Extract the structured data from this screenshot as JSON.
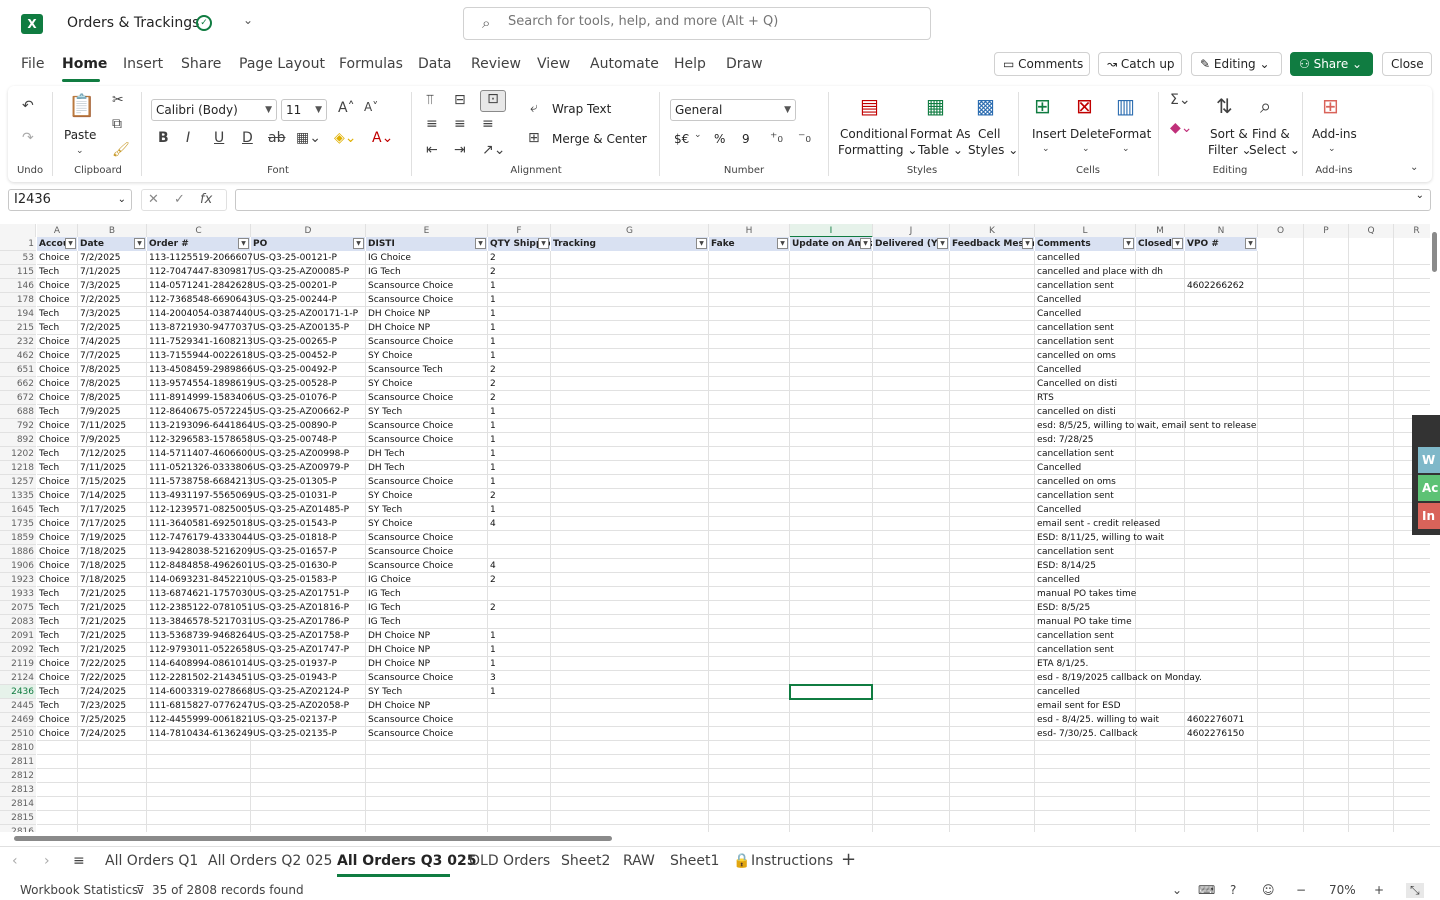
{
  "app": {
    "title": "Orders & Trackings",
    "logo_letter": "X",
    "search_placeholder": "Search for tools, help, and more (Alt + Q)"
  },
  "menu": [
    "File",
    "Home",
    "Insert",
    "Share",
    "Page Layout",
    "Formulas",
    "Data",
    "Review",
    "View",
    "Automate",
    "Help",
    "Draw"
  ],
  "top_buttons": {
    "comments": "Comments",
    "catchup": "Catch up",
    "editing": "Editing",
    "share": "Share",
    "close": "Close"
  },
  "ribbon": {
    "undo_label": "Undo",
    "paste": "Paste",
    "clipboard": "Clipboard",
    "font_name": "Calibri (Body)",
    "font_size": "11",
    "font": "Font",
    "wrap_text": "Wrap Text",
    "merge_center": "Merge & Center",
    "alignment": "Alignment",
    "number_format": "General",
    "number": "Number",
    "currency": "$€",
    "percent": "%",
    "comma": "9",
    "conditional": "Conditional",
    "formatting": "Formatting",
    "format_as": "Format As",
    "table": "Table",
    "cell": "Cell",
    "styles_btn": "Styles",
    "styles": "Styles",
    "insert": "Insert",
    "delete": "Delete",
    "format": "Format",
    "cells": "Cells",
    "sort": "Sort &",
    "filter": "Filter",
    "find": "Find &",
    "select": "Select",
    "editing": "Editing",
    "addins": "Add-ins",
    "addins_group": "Add-ins"
  },
  "formula_bar": {
    "name_box": "I2436",
    "fx": "fx",
    "formula": ""
  },
  "columns": [
    "A",
    "B",
    "C",
    "D",
    "E",
    "F",
    "G",
    "H",
    "I",
    "J",
    "K",
    "L",
    "M",
    "N",
    "O",
    "P",
    "Q",
    "R"
  ],
  "headers": [
    "Accou",
    "Date",
    "Order #",
    "PO",
    "DISTI",
    "QTY Shipped",
    "Tracking",
    "Fake",
    "Update on Amazon",
    "Delivered (Y/N)",
    "Feedback Message",
    "Comments",
    "Closed",
    "VPO #"
  ],
  "header_row_num": "1",
  "rows": [
    {
      "n": "53",
      "a": "Choice",
      "b": "7/2/2025",
      "c": "113-1125519-2066607",
      "d": "US-Q3-25-00121-P",
      "e": "IG Choice",
      "f": "2",
      "l": "cancelled",
      "nvpo": ""
    },
    {
      "n": "115",
      "a": "Tech",
      "b": "7/1/2025",
      "c": "112-7047447-8309817",
      "d": "US-Q3-25-AZ00085-P",
      "e": "IG Tech",
      "f": "2",
      "l": "cancelled and place with dh",
      "nvpo": ""
    },
    {
      "n": "146",
      "a": "Choice",
      "b": "7/3/2025",
      "c": "114-0571241-2842628",
      "d": "US-Q3-25-00201-P",
      "e": "Scansource Choice",
      "f": "1",
      "l": "cancellation sent",
      "nvpo": "4602266262"
    },
    {
      "n": "178",
      "a": "Choice",
      "b": "7/2/2025",
      "c": "112-7368548-6690643",
      "d": "US-Q3-25-00244-P",
      "e": "Scansource Choice",
      "f": "1",
      "l": "Cancelled",
      "nvpo": ""
    },
    {
      "n": "194",
      "a": "Tech",
      "b": "7/3/2025",
      "c": "114-2004054-0387440",
      "d": "US-Q3-25-AZ00171-1-P",
      "e": "DH Choice NP",
      "f": "1",
      "l": "Cancelled",
      "nvpo": ""
    },
    {
      "n": "215",
      "a": "Tech",
      "b": "7/2/2025",
      "c": "113-8721930-9477037",
      "d": "US-Q3-25-AZ00135-P",
      "e": "DH Choice NP",
      "f": "1",
      "l": "cancellation sent",
      "nvpo": ""
    },
    {
      "n": "232",
      "a": "Choice",
      "b": "7/4/2025",
      "c": "111-7529341-1608213",
      "d": "US-Q3-25-00265-P",
      "e": "Scansource Choice",
      "f": "1",
      "l": "cancellation sent",
      "nvpo": ""
    },
    {
      "n": "462",
      "a": "Choice",
      "b": "7/7/2025",
      "c": "113-7155944-0022618",
      "d": "US-Q3-25-00452-P",
      "e": "SY Choice",
      "f": "1",
      "l": "cancelled on oms",
      "nvpo": ""
    },
    {
      "n": "651",
      "a": "Choice",
      "b": "7/8/2025",
      "c": "113-4508459-2989866",
      "d": "US-Q3-25-00492-P",
      "e": "Scansource Tech",
      "f": "2",
      "l": "Cancelled",
      "nvpo": ""
    },
    {
      "n": "662",
      "a": "Choice",
      "b": "7/8/2025",
      "c": "113-9574554-1898619",
      "d": "US-Q3-25-00528-P",
      "e": "SY Choice",
      "f": "2",
      "l": "Cancelled on disti",
      "nvpo": ""
    },
    {
      "n": "672",
      "a": "Choice",
      "b": "7/8/2025",
      "c": "111-8914999-1583406",
      "d": "US-Q3-25-01076-P",
      "e": "Scansource Choice",
      "f": "2",
      "l": "RTS",
      "nvpo": ""
    },
    {
      "n": "688",
      "a": "Tech",
      "b": "7/9/2025",
      "c": "112-8640675-0572245",
      "d": "US-Q3-25-AZ00662-P",
      "e": "SY Tech",
      "f": "1",
      "l": "cancelled on disti",
      "nvpo": ""
    },
    {
      "n": "792",
      "a": "Choice",
      "b": "7/11/2025",
      "c": "113-2193096-6441864",
      "d": "US-Q3-25-00890-P",
      "e": "Scansource Choice",
      "f": "1",
      "l": "esd: 8/5/25, willing to wait, email sent to release",
      "nvpo": ""
    },
    {
      "n": "892",
      "a": "Choice",
      "b": "7/9/2025",
      "c": "112-3296583-1578658",
      "d": "US-Q3-25-00748-P",
      "e": "Scansource Choice",
      "f": "1",
      "l": "esd: 7/28/25",
      "nvpo": ""
    },
    {
      "n": "1202",
      "a": "Tech",
      "b": "7/12/2025",
      "c": "114-5711407-4606600",
      "d": "US-Q3-25-AZ00998-P",
      "e": "DH Tech",
      "f": "1",
      "l": "cancellation sent",
      "nvpo": ""
    },
    {
      "n": "1218",
      "a": "Tech",
      "b": "7/11/2025",
      "c": "111-0521326-0333806",
      "d": "US-Q3-25-AZ00979-P",
      "e": "DH Tech",
      "f": "1",
      "l": "Cancelled",
      "nvpo": ""
    },
    {
      "n": "1257",
      "a": "Choice",
      "b": "7/15/2025",
      "c": "111-5738758-6684213",
      "d": "US-Q3-25-01305-P",
      "e": "Scansource Choice",
      "f": "1",
      "l": "cancelled on oms",
      "nvpo": ""
    },
    {
      "n": "1335",
      "a": "Choice",
      "b": "7/14/2025",
      "c": "113-4931197-5565069",
      "d": "US-Q3-25-01031-P",
      "e": "SY Choice",
      "f": "2",
      "l": "cancellation sent",
      "nvpo": ""
    },
    {
      "n": "1645",
      "a": "Tech",
      "b": "7/17/2025",
      "c": "112-1239571-0825005",
      "d": "US-Q3-25-AZ01485-P",
      "e": "SY Tech",
      "f": "1",
      "l": "Cancelled",
      "nvpo": ""
    },
    {
      "n": "1735",
      "a": "Choice",
      "b": "7/17/2025",
      "c": "111-3640581-6925018",
      "d": "US-Q3-25-01543-P",
      "e": "SY Choice",
      "f": "4",
      "l": "email sent - credit released",
      "nvpo": ""
    },
    {
      "n": "1859",
      "a": "Choice",
      "b": "7/19/2025",
      "c": "112-7476179-4333044",
      "d": "US-Q3-25-01818-P",
      "e": "Scansource Choice",
      "f": "",
      "l": "ESD: 8/11/25, willing to wait",
      "nvpo": ""
    },
    {
      "n": "1886",
      "a": "Choice",
      "b": "7/18/2025",
      "c": "113-9428038-5216209",
      "d": "US-Q3-25-01657-P",
      "e": "Scansource Choice",
      "f": "",
      "l": "cancellation sent",
      "nvpo": ""
    },
    {
      "n": "1906",
      "a": "Choice",
      "b": "7/18/2025",
      "c": "112-8484858-4962601",
      "d": "US-Q3-25-01630-P",
      "e": "Scansource Choice",
      "f": "4",
      "l": "ESD: 8/14/25",
      "nvpo": ""
    },
    {
      "n": "1923",
      "a": "Choice",
      "b": "7/18/2025",
      "c": "114-0693231-8452210",
      "d": "US-Q3-25-01583-P",
      "e": "IG Choice",
      "f": "2",
      "l": "cancelled",
      "nvpo": ""
    },
    {
      "n": "1933",
      "a": "Tech",
      "b": "7/21/2025",
      "c": "113-6874621-1757030",
      "d": "US-Q3-25-AZ01751-P",
      "e": "IG Tech",
      "f": "",
      "l": "manual PO takes time",
      "nvpo": ""
    },
    {
      "n": "2075",
      "a": "Tech",
      "b": "7/21/2025",
      "c": "112-2385122-0781051",
      "d": "US-Q3-25-AZ01816-P",
      "e": "IG Tech",
      "f": "2",
      "l": " ESD:  8/5/25",
      "nvpo": ""
    },
    {
      "n": "2083",
      "a": "Tech",
      "b": "7/21/2025",
      "c": "113-3846578-5217031",
      "d": "US-Q3-25-AZ01786-P",
      "e": "IG Tech",
      "f": "",
      "l": "manual PO take time",
      "nvpo": ""
    },
    {
      "n": "2091",
      "a": "Tech",
      "b": "7/21/2025",
      "c": "113-5368739-9468264",
      "d": "US-Q3-25-AZ01758-P",
      "e": "DH Choice NP",
      "f": "1",
      "l": "cancellation sent",
      "nvpo": ""
    },
    {
      "n": "2092",
      "a": "Tech",
      "b": "7/21/2025",
      "c": "112-9793011-0522658",
      "d": "US-Q3-25-AZ01747-P",
      "e": "DH Choice NP",
      "f": "1",
      "l": "cancellation sent",
      "nvpo": ""
    },
    {
      "n": "2119",
      "a": "Choice",
      "b": "7/22/2025",
      "c": "114-6408994-0861014",
      "d": "US-Q3-25-01937-P",
      "e": "DH Choice NP",
      "f": "1",
      "l": "ETA 8/1/25.",
      "nvpo": ""
    },
    {
      "n": "2124",
      "a": "Choice",
      "b": "7/22/2025",
      "c": "112-2281502-2143451",
      "d": "US-Q3-25-01943-P",
      "e": "Scansource Choice",
      "f": "3",
      "l": "esd - 8/19/2025 callback on Monday.",
      "nvpo": ""
    },
    {
      "n": "2436",
      "a": "Tech",
      "b": "7/24/2025",
      "c": "114-6003319-0278668",
      "d": "US-Q3-25-AZ02124-P",
      "e": "SY Tech",
      "f": "1",
      "l": "cancelled",
      "nvpo": ""
    },
    {
      "n": "2445",
      "a": "Tech",
      "b": "7/23/2025",
      "c": "111-6815827-0776247",
      "d": "US-Q3-25-AZ02058-P",
      "e": "DH Choice NP",
      "f": "",
      "l": "email sent for ESD",
      "nvpo": ""
    },
    {
      "n": "2469",
      "a": "Choice",
      "b": "7/25/2025",
      "c": "112-4455999-0061821",
      "d": "US-Q3-25-02137-P",
      "e": "Scansource Choice",
      "f": "",
      "l": "esd - 8/4/25. willing to wait",
      "nvpo": "4602276071"
    },
    {
      "n": "2510",
      "a": "Choice",
      "b": "7/24/2025",
      "c": "114-7810434-6136249",
      "d": "US-Q3-25-02135-P",
      "e": "Scansource Choice",
      "f": "",
      "l": "esd- 7/30/25. Callback",
      "nvpo": "4602276150"
    }
  ],
  "empty_rows": [
    "2810",
    "2811",
    "2812",
    "2813",
    "2814",
    "2815",
    "2816"
  ],
  "sheets": [
    "All Orders Q1",
    "All Orders Q2 025",
    "All Orders Q3 025",
    "OLD Orders",
    "Sheet2",
    "RAW",
    "Sheet1",
    "Instructions"
  ],
  "status": {
    "workbook_stats": "Workbook Statistics",
    "records": "35 of 2808 records found",
    "zoom": "70%"
  },
  "side_panel": {
    "w": "W",
    "a": "Ac",
    "i": "In"
  }
}
